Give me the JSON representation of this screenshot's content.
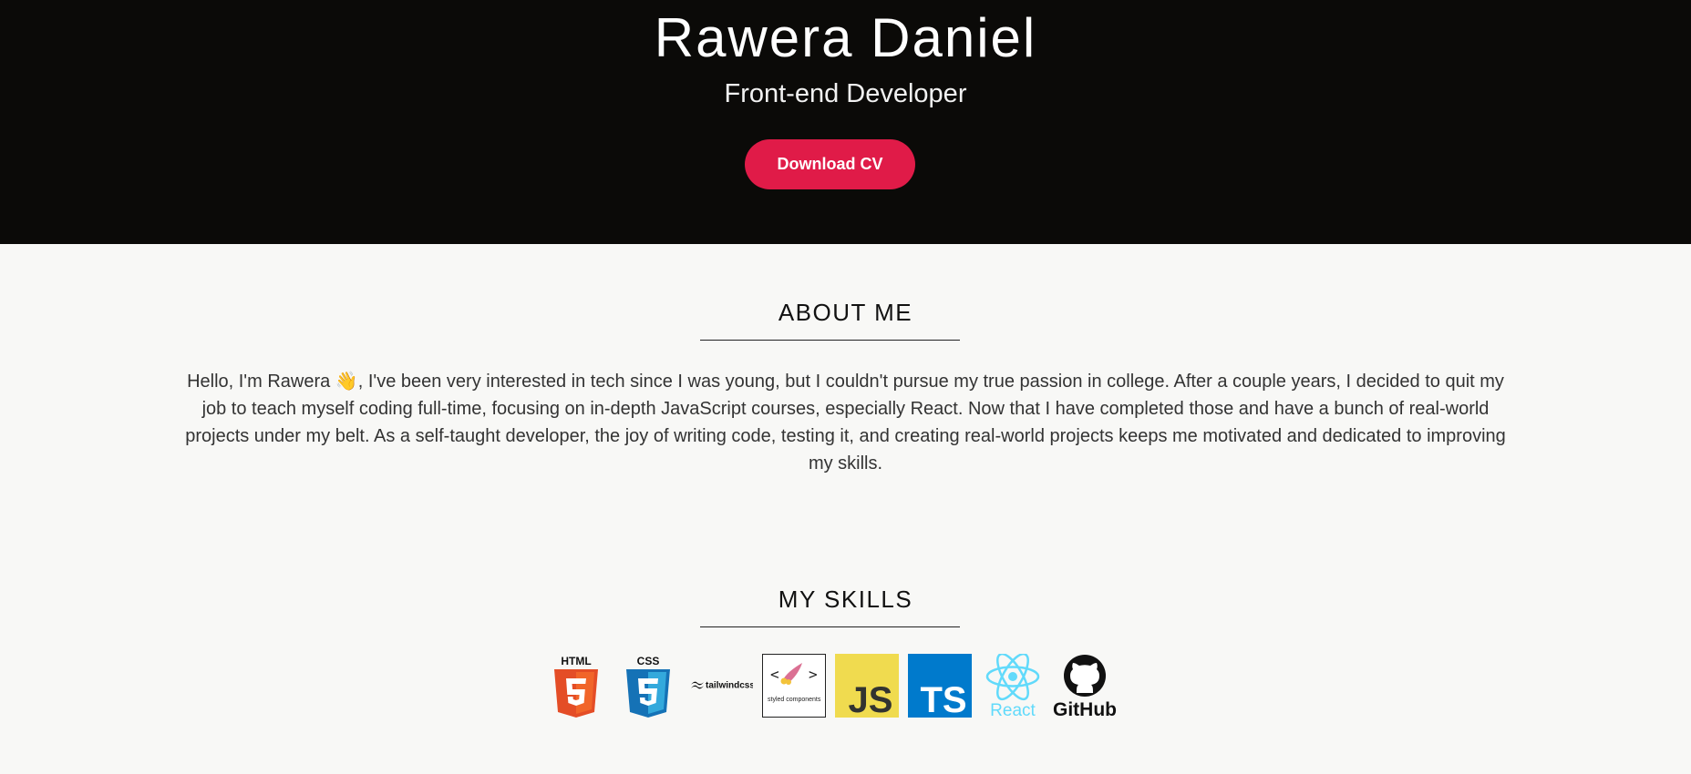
{
  "hero": {
    "name": "Rawera Daniel",
    "role": "Front-end Developer",
    "download_label": "Download CV",
    "background": "#0b0a08",
    "accent": "#e01b48"
  },
  "about": {
    "title": "ABOUT ME",
    "text": "Hello, I'm Rawera 👋, I've been very interested in tech since I was young, but I couldn't pursue my true passion in college. After a couple years, I decided to quit my job to teach myself coding full-time, focusing on in-depth JavaScript courses, especially React. Now that I have completed those and have a bunch of real-world projects under my belt. As a self-taught developer, the joy of writing code, testing it, and creating real-world projects keeps me motivated and dedicated to improving my skills."
  },
  "skills": {
    "title": "MY SKILLS",
    "items": [
      {
        "icon": "html5-icon",
        "label": "HTML",
        "color": "#e44d26"
      },
      {
        "icon": "css3-icon",
        "label": "CSS",
        "color": "#1572b6"
      },
      {
        "icon": "tailwindcss-icon",
        "label": "tailwindcss",
        "color": "#111111"
      },
      {
        "icon": "styled-components-icon",
        "label": "styled components",
        "color": "#db7093"
      },
      {
        "icon": "javascript-icon",
        "label": "JS",
        "color": "#f0db4f"
      },
      {
        "icon": "typescript-icon",
        "label": "TS",
        "color": "#007acc"
      },
      {
        "icon": "react-icon",
        "label": "React",
        "color": "#61dafb"
      },
      {
        "icon": "github-icon",
        "label": "GitHub",
        "color": "#111111"
      }
    ]
  }
}
